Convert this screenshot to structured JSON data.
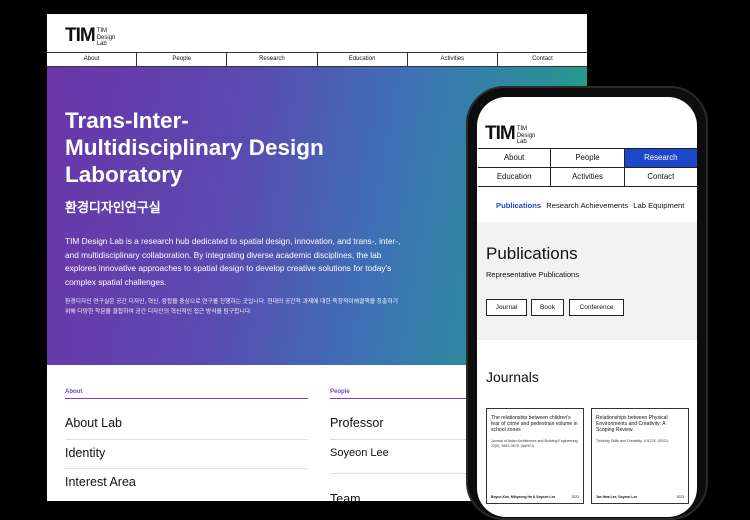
{
  "brand": {
    "mark": "TIM",
    "line1": "TIM",
    "line2": "Design",
    "line3": "Lab"
  },
  "desktop": {
    "nav": [
      "About",
      "People",
      "Research",
      "Education",
      "Activities",
      "Contact"
    ],
    "hero": {
      "title": "Trans-Inter-Multidisciplinary Design Laboratory",
      "title_ko": "환경디자인연구실",
      "description": "TIM Design Lab is a research hub dedicated to spatial design, innovation, and trans-, inter-, and multidisciplinary collaboration. By integrating diverse academic disciplines, the lab explores innovative approaches to spatial design to develop creative solutions for today's complex spatial challenges.",
      "description_ko": "환경디자인 연구실은 공간 디자인, 혁신, 융합을 중심으로 연구를 진행하는 곳입니다. 현대의 공간적 과제에 대한 독창적이해결책을 창출하기 위해 다양한 학문을 결합하여 공간 디자인의 혁신적인 접근 방식을 탐구합니다."
    },
    "about": {
      "label": "About",
      "items": [
        "About Lab",
        "Identity",
        "Interest Area"
      ]
    },
    "people": {
      "label": "People",
      "items": [
        "Professor",
        "Soyeon Lee",
        "Team"
      ]
    }
  },
  "mobile": {
    "nav": [
      [
        "About",
        "People",
        "Research"
      ],
      [
        "Education",
        "Activities",
        "Contact"
      ]
    ],
    "tabs": [
      "Publications",
      "Research Achievements",
      "Lab Equipment"
    ],
    "publications": {
      "title": "Publications",
      "subtitle": "Representative Publications",
      "buttons": [
        "Journal",
        "Book",
        "Conference"
      ]
    },
    "journals_title": "Journals",
    "cards": [
      {
        "title": "The relationship between children's fear of crime and pedestrian volume in school zones",
        "source": "Journal of Asian Architecture and Building Engineering, 22(6), 3663-3679. (A&HCI)",
        "authors": "Boyun Kim, Mihyeong Ha & Soyeon Lee",
        "year": "2023"
      },
      {
        "title": "Relationships between Physical Environments and Creativity: A Scoping Review.",
        "source": "Thinking Skills and Creativity, 101276. (SSCI)",
        "authors": "Jae Hwa Lee, Soyeon Lee",
        "year": "2023"
      }
    ]
  },
  "colors": {
    "active": "#1d47c9",
    "accent": "#7a3fbf",
    "gradient_start": "#6a35a8",
    "gradient_end": "#1fae6d"
  }
}
